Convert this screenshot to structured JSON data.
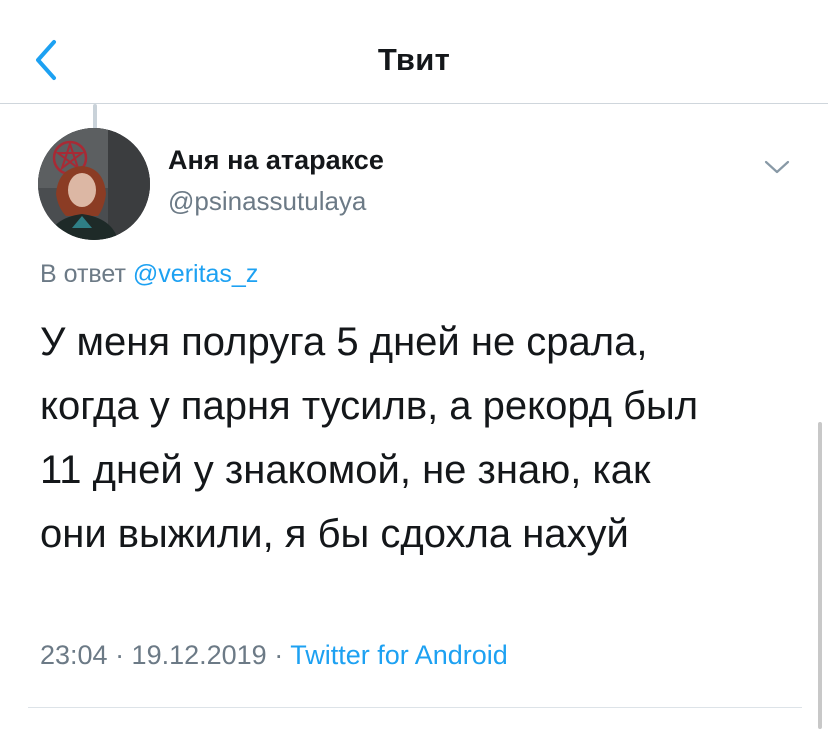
{
  "header": {
    "title": "Твит",
    "back_icon": "chevron-left-icon"
  },
  "tweet": {
    "author": {
      "display_name": "Аня на атараксе",
      "handle": "@psinassutulaya"
    },
    "reply": {
      "prefix": "В ответ",
      "to": "@veritas_z"
    },
    "text": "У меня полруга 5 дней не срала,\nкогда у парня тусилв, а рекорд был\n11 дней у знакомой, не знаю, как\nони выжили, я бы сдохла нахуй",
    "timestamp": "23:04 · 19.12.2019 · ",
    "source": "Twitter for Android",
    "menu_icon": "chevron-down-icon"
  },
  "colors": {
    "accent": "#1da1f2",
    "secondary_text": "#6c7a86",
    "primary_text": "#14171a"
  }
}
